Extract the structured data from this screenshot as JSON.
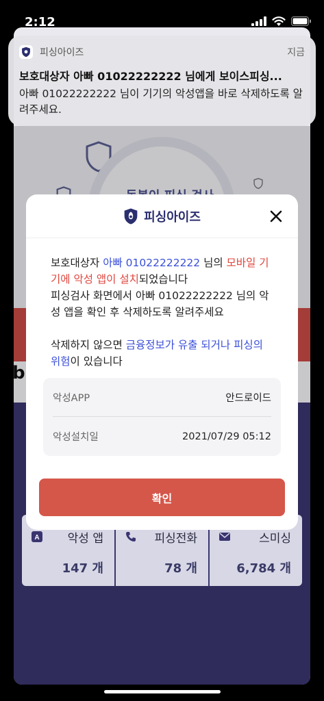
{
  "status_bar": {
    "time": "2:12"
  },
  "notification": {
    "app_name": "피싱아이즈",
    "time": "지금",
    "title": "보호대상자 아빠 01022222222 님에게 보이스피싱...",
    "body": "아빠 01022222222 님이 기기의 악성앱을 바로 삭제하도록 알려주세요."
  },
  "background_app": {
    "scan_text": "동봉이 피싱 검사",
    "side_letter": "b",
    "stats": [
      {
        "icon": "app-icon",
        "label": "악성 앱",
        "count": "147 개"
      },
      {
        "icon": "phone-icon",
        "label": "피싱전화",
        "count": "78 개"
      },
      {
        "icon": "mail-icon",
        "label": "스미싱",
        "count": "6,784 개"
      }
    ]
  },
  "modal": {
    "brand": "피싱아이즈",
    "msg1": {
      "p1": "보호대상자 ",
      "p2": "아빠 01022222222",
      "p3": " 님의 ",
      "p4": "모바일 기기에 악성 앱이 설치",
      "p5": "되었습니다",
      "line2": "피싱검사 화면에서 아빠 01022222222 님의 악성 앱을 확인 후 삭제하도록 알려주세요"
    },
    "msg2": {
      "p1": "삭제하지 않으면 ",
      "p2": "금융정보가 유출 되거나 피싱의 위험",
      "p3": "이 있습니다"
    },
    "info": [
      {
        "label": "악성APP",
        "value": "안드로이드"
      },
      {
        "label": "악성설치일",
        "value": "2021/07/29 05:12"
      }
    ],
    "confirm_label": "확인"
  },
  "colors": {
    "accent_red": "#d4574a",
    "brand_navy": "#2b2f6e",
    "highlight_blue": "#3a4fd8",
    "highlight_red": "#e0463e"
  }
}
